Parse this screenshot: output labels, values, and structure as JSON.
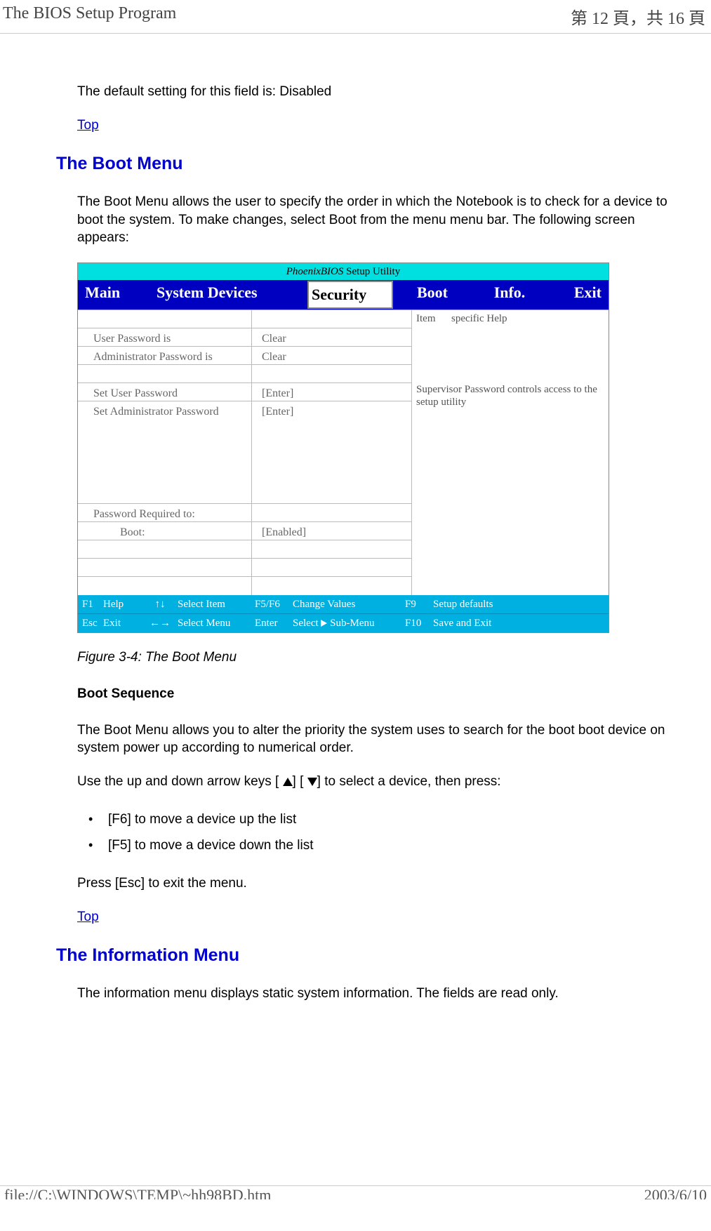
{
  "header": {
    "title": "The BIOS Setup Program",
    "page_indicator": "第 12 頁，共 16 頁"
  },
  "intro": {
    "default_text": "The default setting for this field is: Disabled",
    "top_link": "Top"
  },
  "boot_menu": {
    "heading": "The Boot Menu",
    "description": "The Boot Menu allows the user to specify the order in which the Notebook is to check for a device to boot the system. To make changes, select Boot from the menu menu bar. The following screen appears:",
    "figure_caption": "Figure 3-4: The Boot Menu",
    "sub_heading": "Boot Sequence",
    "sub_para1": "The Boot Menu allows you to alter the priority the system uses to search for the boot boot device on system power up according to numerical order.",
    "sub_para2_pre": "Use the up and down arrow keys [ ",
    "sub_para2_mid": "] [ ",
    "sub_para2_post": "] to select a device, then press:",
    "bullets": [
      "[F6] to move a device up the list",
      "[F5] to move a device down the list"
    ],
    "esc_text": "Press [Esc] to exit the menu.",
    "top_link": "Top"
  },
  "bios": {
    "title_prefix": "PhoenixBIOS",
    "title_suffix": " Setup Utility",
    "tabs": {
      "main": "Main",
      "system_devices": "System Devices",
      "security": "Security",
      "boot": "Boot",
      "info": "Info.",
      "exit": "Exit"
    },
    "rows": {
      "user_pw_is": "User Password is",
      "admin_pw_is": "Administrator Password is",
      "set_user_pw": "Set User Password",
      "set_admin_pw": "Set Administrator Password",
      "pw_required": "Password Required to:",
      "boot_label": "Boot:"
    },
    "values": {
      "clear1": "Clear",
      "clear2": "Clear",
      "enter1": "[Enter]",
      "enter2": "[Enter]",
      "enabled": "[Enabled]"
    },
    "help": {
      "item_specific": "Item      specific Help",
      "supervisor": "Supervisor Password controls access to the setup utility"
    },
    "footer": {
      "f1": "F1",
      "help": "Help",
      "select_item": "Select Item",
      "f5f6": "F5/F6",
      "change_values": "Change Values",
      "f9": "F9",
      "setup_defaults": "Setup defaults",
      "esc": "Esc",
      "exit": "Exit",
      "select_menu": "Select Menu",
      "enter": "Enter",
      "select_sub": "Select",
      "sub_menu": " Sub-Menu",
      "f10": "F10",
      "save_exit": "Save and Exit"
    }
  },
  "info_menu": {
    "heading": "The Information Menu",
    "description": "The information menu displays static system information. The fields are read only."
  },
  "footer": {
    "path": "file://C:\\WINDOWS\\TEMP\\~hh98BD.htm",
    "date": "2003/6/10"
  }
}
